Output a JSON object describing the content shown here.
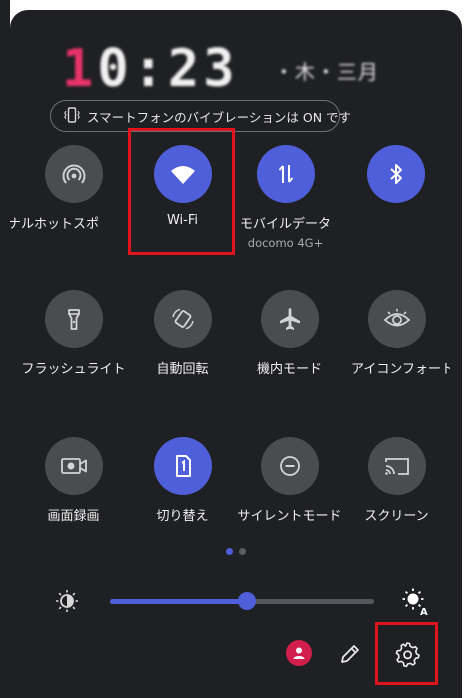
{
  "clock": {
    "prefix": "1",
    "time": "0:23",
    "date": "・木・三月"
  },
  "vibration_notice": "スマートフォンのバイブレーションは ON です",
  "tiles": [
    {
      "name": "tile-hotspot",
      "label": "ナルホットスポ",
      "icon": "hotspot-icon",
      "on": false
    },
    {
      "name": "tile-wifi",
      "label": "Wi-Fi",
      "icon": "wifi-icon",
      "on": true
    },
    {
      "name": "tile-mobile-data",
      "label": "モバイルデータ",
      "sub": "docomo 4G+",
      "icon": "data-arrows-icon",
      "on": true
    },
    {
      "name": "tile-bluetooth",
      "label": "",
      "icon": "bluetooth-icon",
      "on": true
    },
    {
      "name": "tile-flashlight",
      "label": "フラッシュライト",
      "icon": "flashlight-icon",
      "on": false
    },
    {
      "name": "tile-auto-rotate",
      "label": "自動回転",
      "icon": "rotate-icon",
      "on": false
    },
    {
      "name": "tile-airplane",
      "label": "機内モード",
      "icon": "airplane-icon",
      "on": false
    },
    {
      "name": "tile-icon-font",
      "label": "アイコンフォート",
      "icon": "eye-icon",
      "on": false
    },
    {
      "name": "tile-screen-record",
      "label": "画面録画",
      "icon": "video-camera-icon",
      "on": false
    },
    {
      "name": "tile-sim-switch",
      "label": "切り替え",
      "icon": "sim-card-icon",
      "on": true
    },
    {
      "name": "tile-silent",
      "label": "サイレントモード",
      "icon": "do-not-disturb-icon",
      "on": false
    },
    {
      "name": "tile-screencast",
      "label": "スクリーン",
      "icon": "cast-icon",
      "on": false
    }
  ],
  "page_indicator": {
    "pages": 2,
    "current": 1
  },
  "brightness": {
    "level": 0.52,
    "low_icon": "brightness-low-icon",
    "auto_icon": "brightness-auto-icon"
  },
  "bottom_bar": {
    "user_icon": "user-avatar-icon",
    "edit_icon": "pencil-icon",
    "settings_icon": "gear-icon"
  },
  "colors": {
    "panel": "#1f2023",
    "accent": "#4f5ed9",
    "tile_off": "#4b4c50",
    "highlight": "#e1141e",
    "avatar": "#d21e4d"
  }
}
